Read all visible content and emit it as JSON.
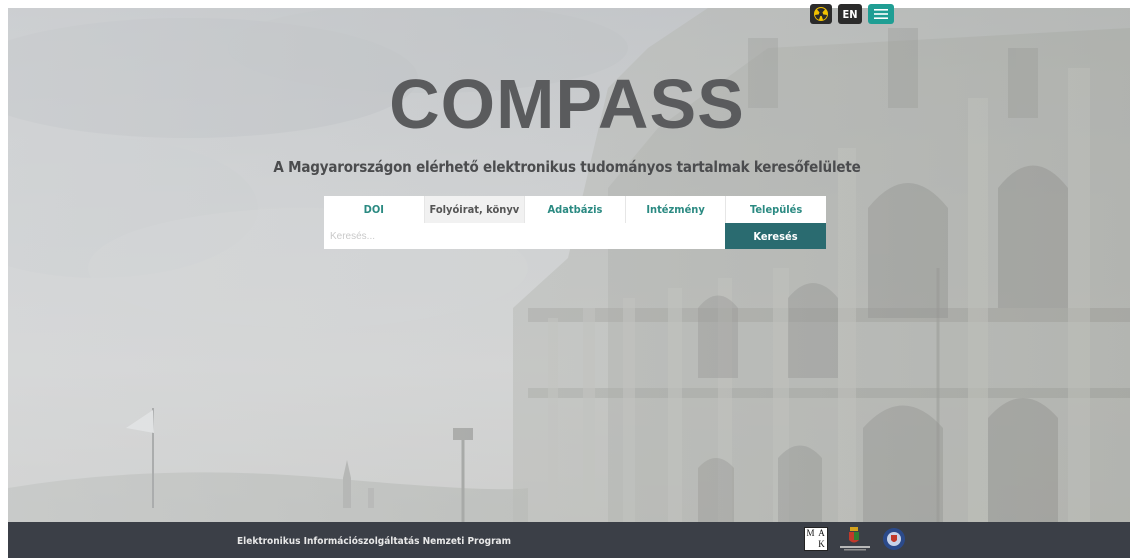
{
  "header": {
    "contrast_icon": "high-contrast-icon",
    "language_label": "EN",
    "menu_icon": "hamburger-menu-icon"
  },
  "hero": {
    "title": "COMPASS",
    "tagline": "A Magyarországon elérhető elektronikus tudományos tartalmak keresőfelülete"
  },
  "search": {
    "tabs": [
      {
        "label": "DOI",
        "active": false
      },
      {
        "label": "Folyóirat, könyv",
        "active": true
      },
      {
        "label": "Adatbázis",
        "active": false
      },
      {
        "label": "Intézmény",
        "active": false
      },
      {
        "label": "Település",
        "active": false
      }
    ],
    "input_value": "",
    "placeholder": "Keresés...",
    "button_label": "Keresés"
  },
  "footer": {
    "program_text": "Elektronikus Információszolgáltatás Nemzeti Program",
    "logo_mak_letters": [
      "M",
      "A",
      "",
      "K"
    ],
    "logos": [
      "mak-logo",
      "hungarian-coat-of-arms-logo",
      "university-seal-logo"
    ]
  },
  "colors": {
    "accent_teal": "#2b8a82",
    "button_dark_teal": "#2a6b70",
    "menu_teal": "#1f9e94",
    "footer_bg": "#3b3f47",
    "title_gray": "#5a5b5d"
  }
}
